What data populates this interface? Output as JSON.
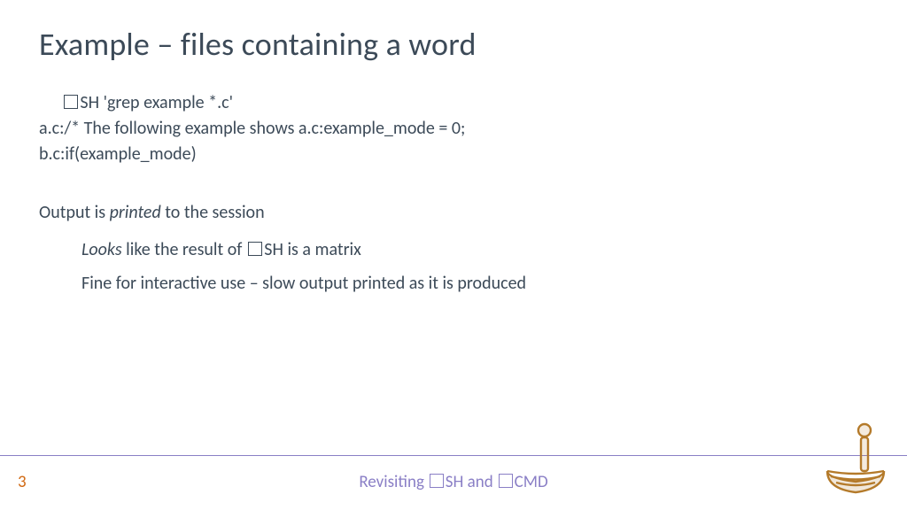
{
  "title": "Example – files containing a word",
  "code": {
    "command_suffix": "SH 'grep example *.c'",
    "out1": "a.c:/* The following example shows a.c:example_mode = 0;",
    "out2": "b.c:if(example_mode)"
  },
  "body": {
    "line1_a": "Output is ",
    "line1_em": "printed",
    "line1_b": " to the session",
    "line2_em": "Looks",
    "line2_a": " like the result of ",
    "line2_b": "SH is a matrix",
    "line3": "Fine for interactive use – slow output printed as it is produced"
  },
  "footer": {
    "page": "3",
    "title_a": "Revisiting ",
    "title_b": "SH and ",
    "title_c": "CMD"
  }
}
